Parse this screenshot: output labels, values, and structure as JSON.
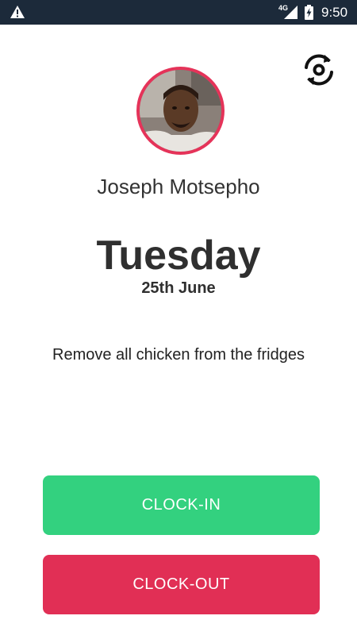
{
  "status_bar": {
    "time": "9:50",
    "network": "4G",
    "icons": [
      "warning-icon",
      "signal-icon",
      "battery-charging-icon"
    ]
  },
  "header": {
    "switch_icon": "switch-camera-icon"
  },
  "profile": {
    "name": "Joseph Motsepho",
    "avatar_border_color": "#e53359"
  },
  "schedule": {
    "day": "Tuesday",
    "date": "25th June"
  },
  "task": {
    "text": "Remove all chicken from the fridges"
  },
  "actions": {
    "clock_in": {
      "label": "CLOCK-IN",
      "color": "#33d17f"
    },
    "clock_out": {
      "label": "CLOCK-OUT",
      "color": "#e12f55"
    }
  },
  "colors": {
    "status_bar": "#1c2a3a",
    "text": "#2f2f2f"
  }
}
